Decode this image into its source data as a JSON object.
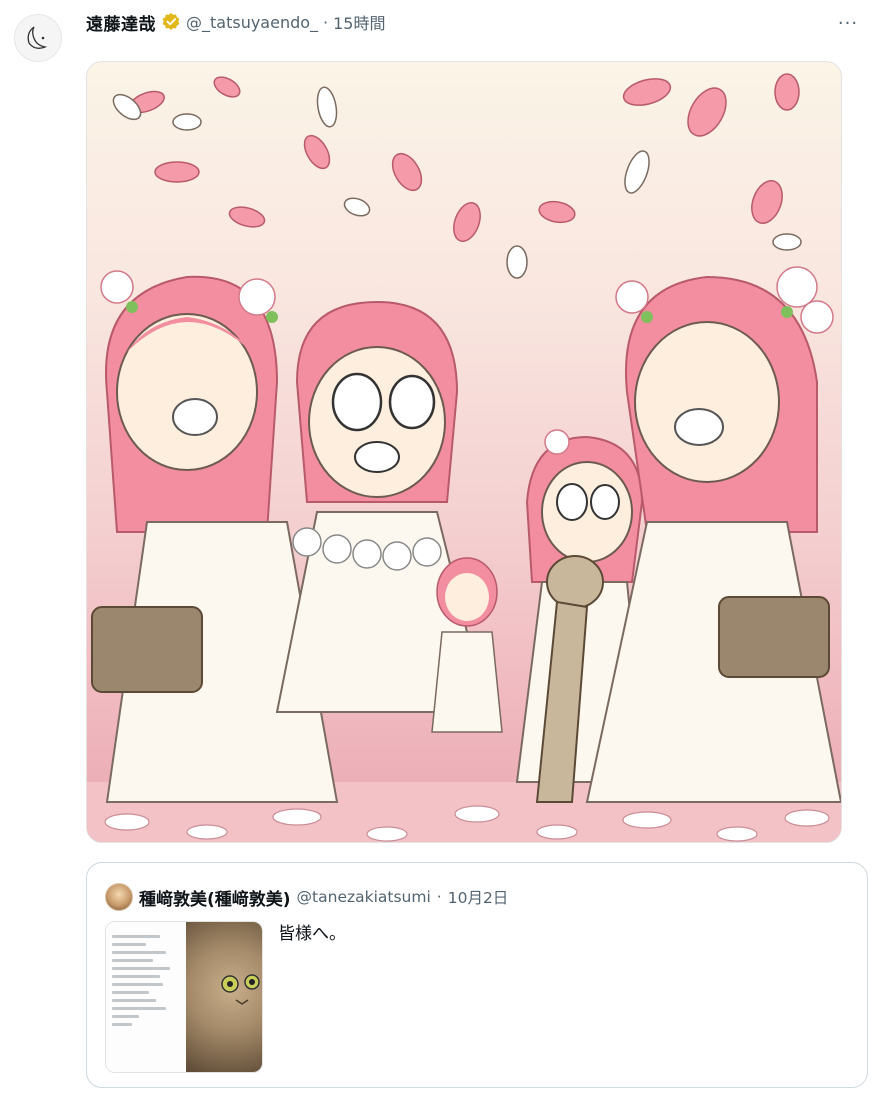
{
  "post": {
    "author_name": "遠藤達哉",
    "handle": "@_tatsuyaendo_",
    "separator": "·",
    "time": "15時間",
    "more_label": "···"
  },
  "media": {
    "icon": "image-illustration",
    "accent_colors": [
      "#f28ea0",
      "#fbf4e7",
      "#efb6bd"
    ]
  },
  "quote": {
    "author_name": "種﨑敦美(種﨑敦美)",
    "handle": "@tanezakiatsumi",
    "separator": "·",
    "time": "10月2日",
    "text": "皆様へ。"
  },
  "colors": {
    "text_primary": "#0f1419",
    "text_secondary": "#536471",
    "border": "#cfd9de",
    "verified_gold": "#e2b719"
  }
}
